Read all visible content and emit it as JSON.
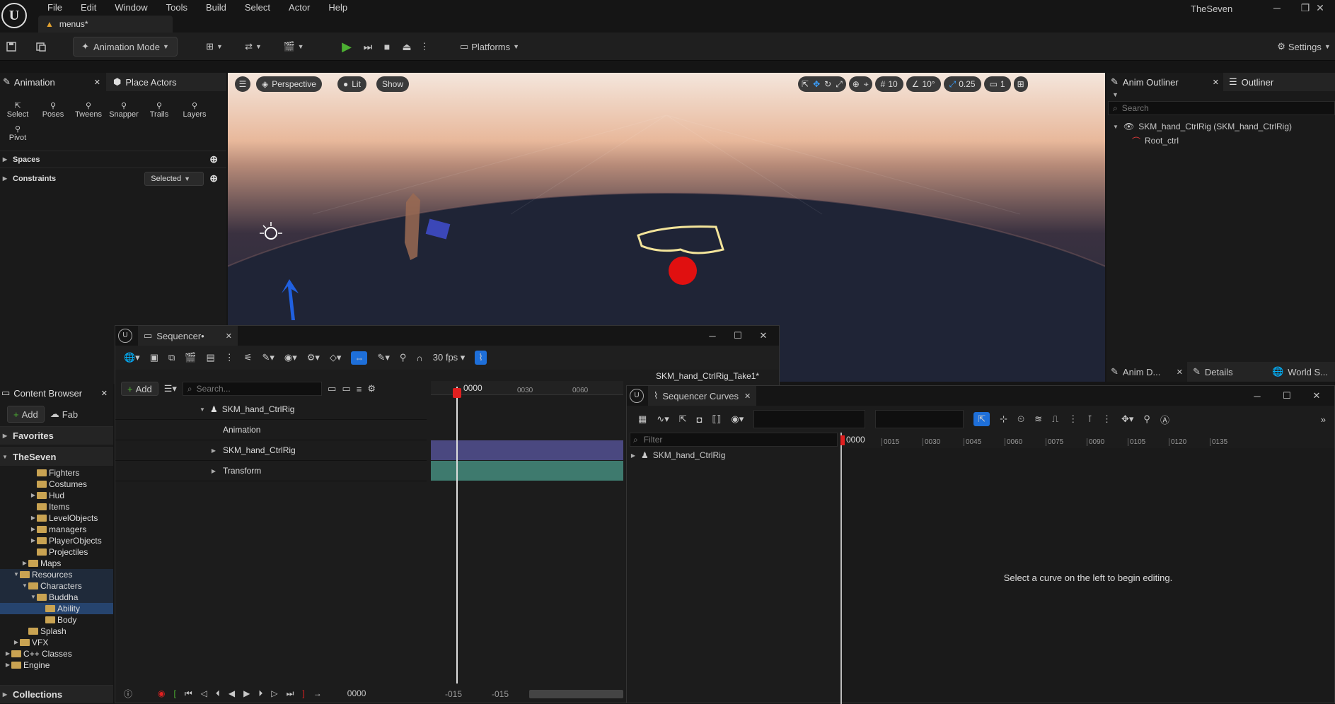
{
  "app": {
    "project": "TheSeven",
    "doc_tab": "menus*",
    "menus": [
      "File",
      "Edit",
      "Window",
      "Tools",
      "Build",
      "Select",
      "Actor",
      "Help"
    ]
  },
  "toolbar": {
    "mode": "Animation Mode",
    "platforms": "Platforms",
    "settings": "Settings"
  },
  "anim_panel": {
    "tab": "Animation",
    "place_tab": "Place Actors",
    "tools": [
      "Select",
      "Poses",
      "Tweens",
      "Snapper",
      "Trails",
      "Layers"
    ],
    "pivot": "Pivot",
    "spaces": "Spaces",
    "constraints": "Constraints",
    "constraints_value": "Selected"
  },
  "viewport": {
    "perspective": "Perspective",
    "lit": "Lit",
    "show": "Show",
    "grid_snap": "10",
    "angle_snap": "10°",
    "scale_snap": "0.25",
    "camera_speed": "1"
  },
  "outliner": {
    "tab1": "Anim Outliner",
    "tab2": "Outliner",
    "search_placeholder": "Search",
    "items": [
      "SKM_hand_CtrlRig (SKM_hand_CtrlRig)",
      "Root_ctrl"
    ]
  },
  "details_tabs": [
    "Anim D...",
    "Details",
    "World S..."
  ],
  "content_browser": {
    "tab": "Content Browser",
    "add": "Add",
    "fab": "Fab",
    "favorites": "Favorites",
    "root": "TheSeven",
    "collections": "Collections",
    "tree": [
      {
        "label": "Fighters",
        "depth": 3,
        "arrow": ""
      },
      {
        "label": "Costumes",
        "depth": 3,
        "arrow": ""
      },
      {
        "label": "Hud",
        "depth": 3,
        "arrow": "▶"
      },
      {
        "label": "Items",
        "depth": 3,
        "arrow": ""
      },
      {
        "label": "LevelObjects",
        "depth": 3,
        "arrow": "▶"
      },
      {
        "label": "managers",
        "depth": 3,
        "arrow": "▶"
      },
      {
        "label": "PlayerObjects",
        "depth": 3,
        "arrow": "▶"
      },
      {
        "label": "Projectiles",
        "depth": 3,
        "arrow": ""
      },
      {
        "label": "Maps",
        "depth": 2,
        "arrow": "▶"
      },
      {
        "label": "Resources",
        "depth": 1,
        "arrow": "▼"
      },
      {
        "label": "Characters",
        "depth": 2,
        "arrow": "▼"
      },
      {
        "label": "Buddha",
        "depth": 3,
        "arrow": "▼"
      },
      {
        "label": "Ability",
        "depth": 4,
        "arrow": ""
      },
      {
        "label": "Body",
        "depth": 4,
        "arrow": ""
      },
      {
        "label": "Splash",
        "depth": 2,
        "arrow": ""
      },
      {
        "label": "VFX",
        "depth": 1,
        "arrow": "▶"
      },
      {
        "label": "C++ Classes",
        "depth": 0,
        "arrow": "▶"
      },
      {
        "label": "Engine",
        "depth": 0,
        "arrow": "▶"
      }
    ]
  },
  "sequencer": {
    "tab": "Sequencer•",
    "fps": "30 fps",
    "add": "Add",
    "search_placeholder": "Search...",
    "sequence_name": "SKM_hand_CtrlRig_Take1*",
    "frame": "0000",
    "ruler": [
      "0030",
      "0060"
    ],
    "range_start": "-015",
    "range_start2": "-015",
    "tracks": [
      "SKM_hand_CtrlRig",
      "Animation",
      "SKM_hand_CtrlRig",
      "Transform"
    ]
  },
  "curves": {
    "tab": "Sequencer Curves",
    "filter_placeholder": "Filter",
    "tree_item": "SKM_hand_CtrlRig",
    "frame": "0000",
    "ruler": [
      "0015",
      "0030",
      "0045",
      "0060",
      "0075",
      "0090",
      "0105",
      "0120",
      "0135"
    ],
    "hint": "Select a curve on the left to begin editing."
  }
}
